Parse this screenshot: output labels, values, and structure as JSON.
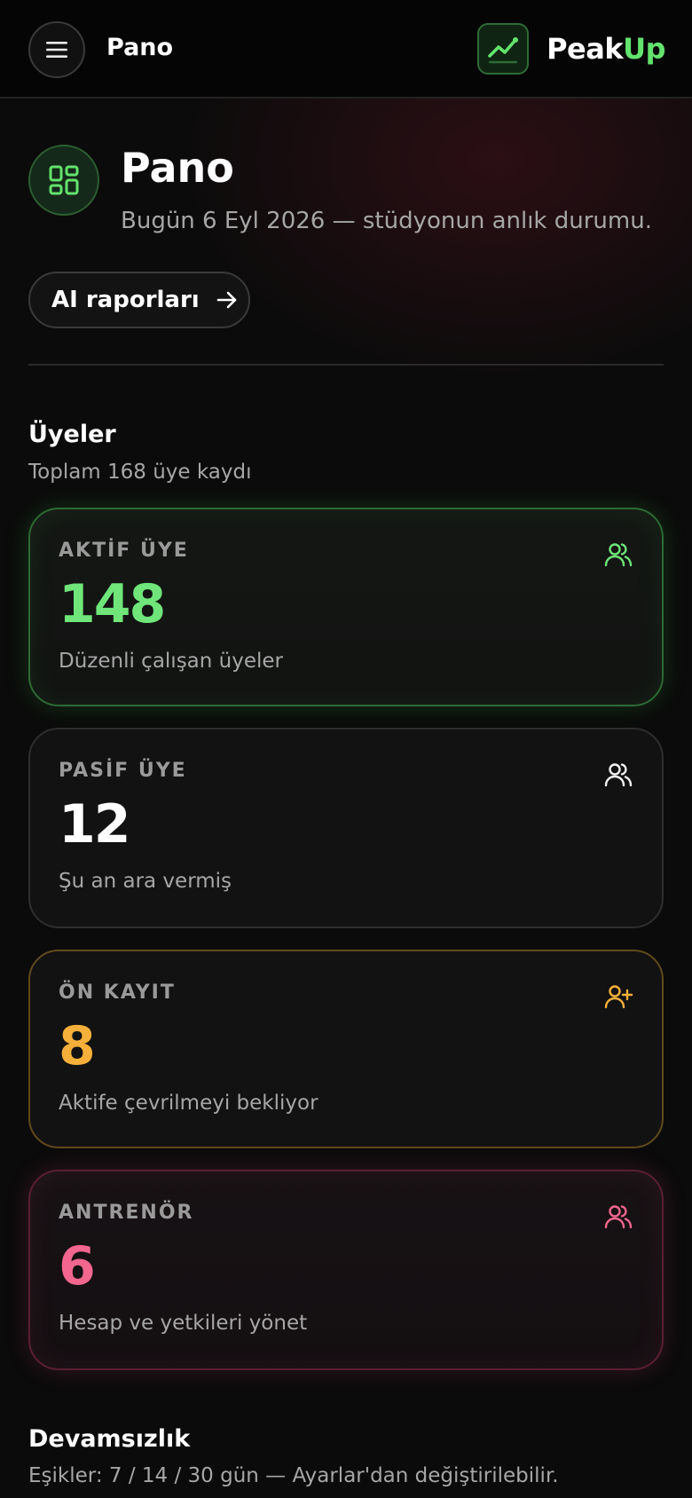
{
  "topbar": {
    "title": "Pano",
    "brand": {
      "part1": "Peak",
      "part2": "Up",
      "accent": "#63e36d"
    },
    "icons": {
      "menu": "menu-icon",
      "logo": "trend-up-icon"
    }
  },
  "header": {
    "icon": "dashboard-grid-icon",
    "title": "Pano",
    "subtitle": "Bugün 6 Eyl 2026 — stüdyonun anlık durumu.",
    "ai_button_label": "AI raporları",
    "ai_button_icon": "arrow-right-icon"
  },
  "members": {
    "title": "Üyeler",
    "subtitle": "Toplam 168 üye kaydı",
    "cards": [
      {
        "label": "AKTİF ÜYE",
        "value": "148",
        "desc": "Düzenli çalışan üyeler",
        "icon": "users-icon",
        "color": "#6fe57a"
      },
      {
        "label": "PASİF ÜYE",
        "value": "12",
        "desc": "Şu an ara vermiş",
        "icon": "users-icon",
        "color": "#ffffff"
      },
      {
        "label": "ÖN KAYIT",
        "value": "8",
        "desc": "Aktife çevrilmeyi bekliyor",
        "icon": "user-plus-icon",
        "color": "#f4b03a"
      },
      {
        "label": "ANTRENÖR",
        "value": "6",
        "desc": "Hesap ve yetkileri yönet",
        "icon": "users-icon",
        "color": "#f2668f"
      }
    ]
  },
  "absence": {
    "title": "Devamsızlık",
    "subtitle": "Eşikler: 7 / 14 / 30 gün — Ayarlar'dan değiştirilebilir."
  }
}
